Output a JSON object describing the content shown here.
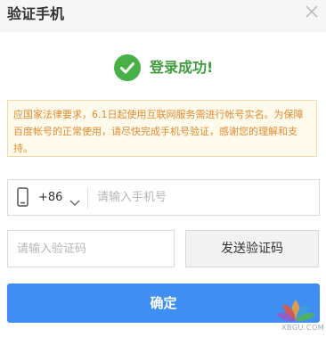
{
  "dialog": {
    "title": "验证手机",
    "close_icon": "close-icon"
  },
  "status": {
    "icon": "checkmark-circle-icon",
    "text": "登录成功!"
  },
  "notice": {
    "text": "应国家法律要求，6.1日起使用互联网服务需进行帐号实名。为保障百度帐号的正常使用，请尽快完成手机号验证，感谢您的理解和支持。"
  },
  "phone": {
    "icon": "phone-icon",
    "country_code": "+86",
    "country_dropdown_icon": "chevron-down-icon",
    "placeholder": "请输入手机号",
    "value": ""
  },
  "code": {
    "placeholder": "请输入验证码",
    "value": "",
    "send_label": "发送验证码"
  },
  "actions": {
    "confirm_label": "确定"
  },
  "watermark": {
    "text": "XBGU.COM"
  },
  "colors": {
    "success_green": "#47b046",
    "notice_border": "#f2d9a6",
    "notice_background": "#fffbec",
    "notice_text": "#e08a2f",
    "primary_button": "#3e8ef3",
    "header_background": "#f6f6f6"
  }
}
